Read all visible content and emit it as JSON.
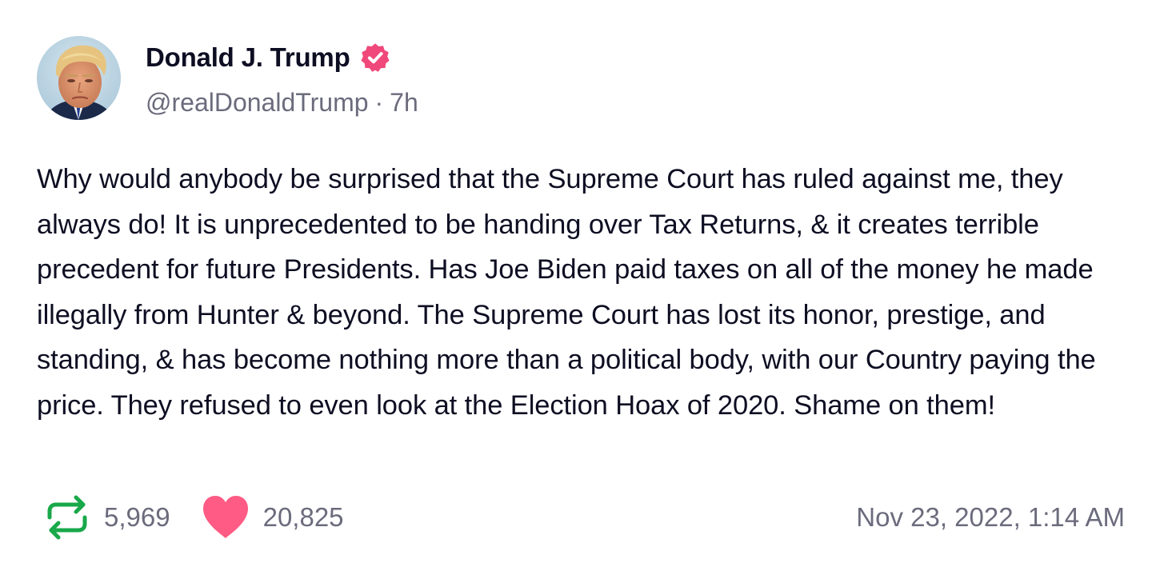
{
  "author": {
    "display_name": "Donald J. Trump",
    "handle": "@realDonaldTrump",
    "relative_time": "7h",
    "separator": "·",
    "verified": true,
    "avatar_icon": "profile-photo"
  },
  "post": {
    "text": "Why would anybody be surprised that the Supreme Court has ruled against me, they always do! It is unprecedented to be handing over Tax Returns, & it creates terrible precedent for future Presidents. Has Joe Biden paid taxes on all of the money he made illegally from Hunter & beyond. The Supreme Court has lost its honor, prestige, and standing, & has become nothing more than a political body, with our Country paying the price. They refused to even look at the Election Hoax of 2020. Shame on them!"
  },
  "stats": {
    "retruths": "5,969",
    "likes": "20,825",
    "timestamp": "Nov 23, 2022, 1:14 AM"
  },
  "colors": {
    "verified_badge": "#f0487a",
    "retruth_icon": "#19a84a",
    "like_icon": "#ff5b84",
    "muted_text": "#6b6b7d",
    "body_text": "#0e0e23"
  },
  "icons": {
    "verified": "verified-badge-icon",
    "retruth": "retruth-arrows-icon",
    "like": "heart-icon"
  }
}
